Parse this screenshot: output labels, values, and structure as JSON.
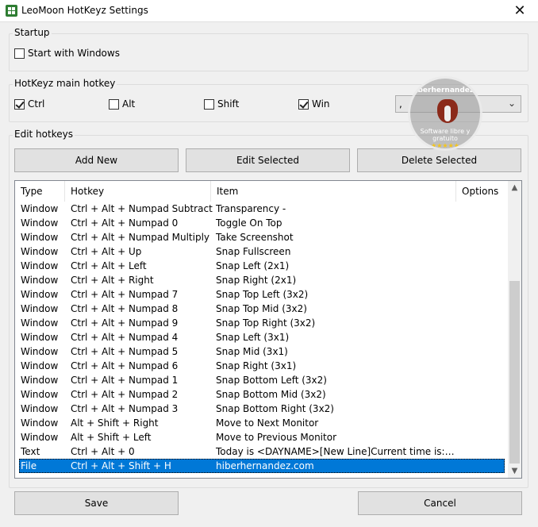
{
  "window": {
    "title": "LeoMoon HotKeyz Settings",
    "close": "✕"
  },
  "startup": {
    "label": "Startup",
    "start_with_windows": "Start with Windows",
    "checked": false
  },
  "main_hotkey": {
    "label": "HotKeyz main hotkey",
    "ctrl": "Ctrl",
    "ctrl_checked": true,
    "alt": "Alt",
    "alt_checked": false,
    "shift": "Shift",
    "shift_checked": false,
    "win": "Win",
    "win_checked": true,
    "key_value": ","
  },
  "edit": {
    "label": "Edit hotkeys",
    "add": "Add New",
    "edit_selected": "Edit Selected",
    "delete_selected": "Delete Selected"
  },
  "table": {
    "headers": [
      "Type",
      "Hotkey",
      "Item",
      "Options"
    ],
    "rows": [
      [
        "Window",
        "Ctrl + Alt + Numpad Subtract",
        "Transparency -",
        ""
      ],
      [
        "Window",
        "Ctrl + Alt + Numpad 0",
        "Toggle On Top",
        ""
      ],
      [
        "Window",
        "Ctrl + Alt + Numpad Multiply",
        "Take Screenshot",
        ""
      ],
      [
        "Window",
        "Ctrl + Alt + Up",
        "Snap Fullscreen",
        ""
      ],
      [
        "Window",
        "Ctrl + Alt + Left",
        "Snap Left (2x1)",
        ""
      ],
      [
        "Window",
        "Ctrl + Alt + Right",
        "Snap Right (2x1)",
        ""
      ],
      [
        "Window",
        "Ctrl + Alt + Numpad 7",
        "Snap Top Left (3x2)",
        ""
      ],
      [
        "Window",
        "Ctrl + Alt + Numpad 8",
        "Snap Top Mid (3x2)",
        ""
      ],
      [
        "Window",
        "Ctrl + Alt + Numpad 9",
        "Snap Top Right (3x2)",
        ""
      ],
      [
        "Window",
        "Ctrl + Alt + Numpad 4",
        "Snap Left (3x1)",
        ""
      ],
      [
        "Window",
        "Ctrl + Alt + Numpad 5",
        "Snap Mid (3x1)",
        ""
      ],
      [
        "Window",
        "Ctrl + Alt + Numpad 6",
        "Snap Right (3x1)",
        ""
      ],
      [
        "Window",
        "Ctrl + Alt + Numpad 1",
        "Snap Bottom Left (3x2)",
        ""
      ],
      [
        "Window",
        "Ctrl + Alt + Numpad 2",
        "Snap Bottom Mid (3x2)",
        ""
      ],
      [
        "Window",
        "Ctrl + Alt + Numpad 3",
        "Snap Bottom Right (3x2)",
        ""
      ],
      [
        "Window",
        "Alt + Shift + Right",
        "Move to Next Monitor",
        ""
      ],
      [
        "Window",
        "Alt + Shift + Left",
        "Move to Previous Monitor",
        ""
      ],
      [
        "Text",
        "Ctrl + Alt + 0",
        "Today is <DAYNAME>[New Line]Current time is: <...",
        ""
      ],
      [
        "File",
        "Ctrl + Alt + Shift + H",
        "hiberhernandez.com",
        ""
      ]
    ],
    "selected_index": 18
  },
  "footer": {
    "save": "Save",
    "cancel": "Cancel"
  },
  "watermark": {
    "site": "hiberhernandez.com",
    "tagline": "Software libre y gratuito",
    "stars": "★★★★★"
  },
  "colors": {
    "selection": "#0078d7"
  }
}
